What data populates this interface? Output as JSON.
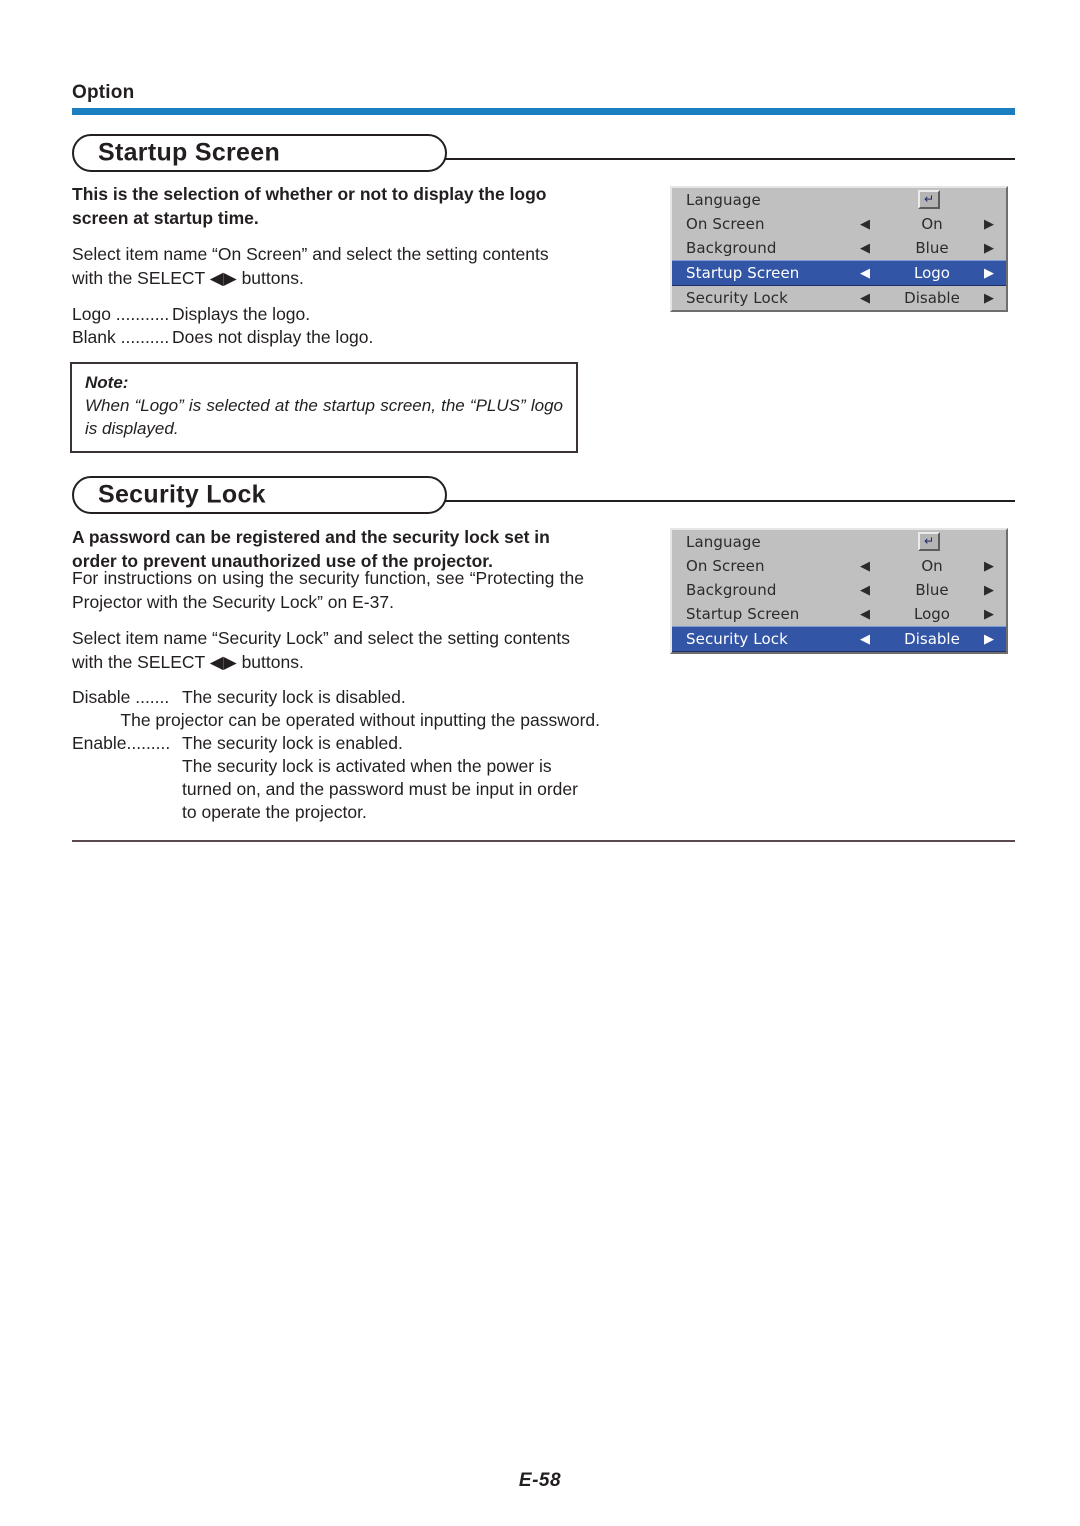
{
  "header": {
    "category": "Option",
    "rule_color": "#1a7fc1"
  },
  "sections": [
    {
      "title": "Startup Screen",
      "intro": "This is the selection of whether or not to display the logo screen at startup time.",
      "instruction": "Select item name “On Screen” and select the setting contents with the SELECT ◀▶ buttons.",
      "definitions": [
        {
          "term": "Logo ...........",
          "desc": "Displays the logo."
        },
        {
          "term": "Blank ..........",
          "desc": "Does not display the logo."
        }
      ],
      "note": {
        "title": "Note:",
        "body": "When “Logo” is selected at the startup screen, the “PLUS” logo is displayed."
      }
    },
    {
      "title": "Security Lock",
      "intro": "A password can be registered and the security lock set in order to prevent unauthorized use of the projector.",
      "reference": "For instructions on using the security function, see “Protecting the Projector with the Security Lock” on E-37.",
      "instruction": "Select item name “Security Lock” and select the setting contents with the SELECT ◀▶ buttons.",
      "definitions": [
        {
          "term": "Disable .......",
          "desc": "The security lock is disabled."
        },
        {
          "term": "",
          "desc": "The projector can be operated without inputting the password."
        },
        {
          "term": "Enable.........",
          "desc": "The security lock is enabled."
        },
        {
          "term": "",
          "desc": "The security lock is activated when the power is turned on, and the password must be input in order to operate the projector."
        }
      ]
    }
  ],
  "osd_menus": [
    {
      "highlighted_index": 3,
      "rows": [
        {
          "label": "Language",
          "value": "",
          "control": "enter-key",
          "left_arrow": "◀",
          "right_arrow": "▶",
          "enter_glyph": "↵"
        },
        {
          "label": "On Screen",
          "value": "On",
          "control": "arrows",
          "left_arrow": "◀",
          "right_arrow": "▶"
        },
        {
          "label": "Background",
          "value": "Blue",
          "control": "arrows",
          "left_arrow": "◀",
          "right_arrow": "▶"
        },
        {
          "label": "Startup Screen",
          "value": "Logo",
          "control": "arrows",
          "left_arrow": "◀",
          "right_arrow": "▶"
        },
        {
          "label": "Security Lock",
          "value": "Disable",
          "control": "arrows",
          "left_arrow": "◀",
          "right_arrow": "▶"
        }
      ]
    },
    {
      "highlighted_index": 4,
      "rows": [
        {
          "label": "Language",
          "value": "",
          "control": "enter-key",
          "left_arrow": "◀",
          "right_arrow": "▶",
          "enter_glyph": "↵"
        },
        {
          "label": "On Screen",
          "value": "On",
          "control": "arrows",
          "left_arrow": "◀",
          "right_arrow": "▶"
        },
        {
          "label": "Background",
          "value": "Blue",
          "control": "arrows",
          "left_arrow": "◀",
          "right_arrow": "▶"
        },
        {
          "label": "Startup Screen",
          "value": "Logo",
          "control": "arrows",
          "left_arrow": "◀",
          "right_arrow": "▶"
        },
        {
          "label": "Security Lock",
          "value": "Disable",
          "control": "arrows",
          "left_arrow": "◀",
          "right_arrow": "▶"
        }
      ]
    }
  ],
  "footer": {
    "page_number": "E-58"
  },
  "colors": {
    "accent_rule": "#1a7fc1",
    "osd_background": "#c0c0c0",
    "osd_highlight": "#3355a5",
    "text": "#231f20"
  }
}
